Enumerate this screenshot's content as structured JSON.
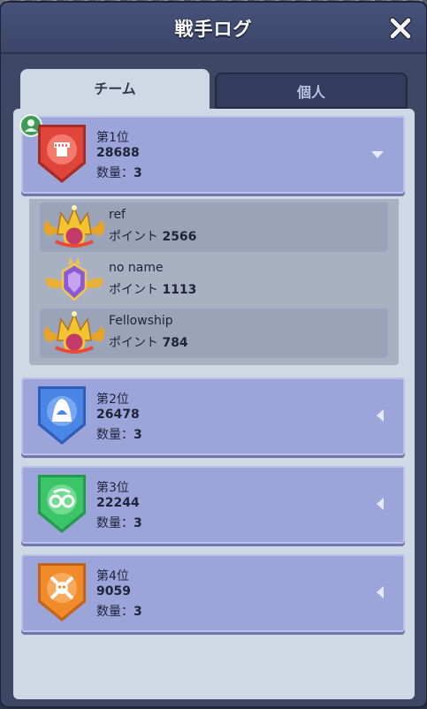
{
  "title": "戦手ログ",
  "tabs": [
    {
      "label": "チーム",
      "active": true
    },
    {
      "label": "個人",
      "active": false
    }
  ],
  "teams": [
    {
      "rank": "第1位",
      "score": "28688",
      "count_label": "数量：",
      "count": "3",
      "color": "#e0453b",
      "expanded": true
    },
    {
      "rank": "第2位",
      "score": "26478",
      "count_label": "数量：",
      "count": "3",
      "color": "#4a86e8",
      "expanded": false
    },
    {
      "rank": "第3位",
      "score": "22244",
      "count_label": "数量：",
      "count": "3",
      "color": "#3cc469",
      "expanded": false
    },
    {
      "rank": "第4位",
      "score": "9059",
      "count_label": "数量：",
      "count": "3",
      "color": "#f08a2a",
      "expanded": false
    }
  ],
  "members": [
    {
      "name": "ref",
      "points_label": "ポイント",
      "points": "2566"
    },
    {
      "name": "no name",
      "points_label": "ポイント",
      "points": "1113"
    },
    {
      "name": "Fellowship",
      "points_label": "ポイント",
      "points": "784"
    }
  ]
}
